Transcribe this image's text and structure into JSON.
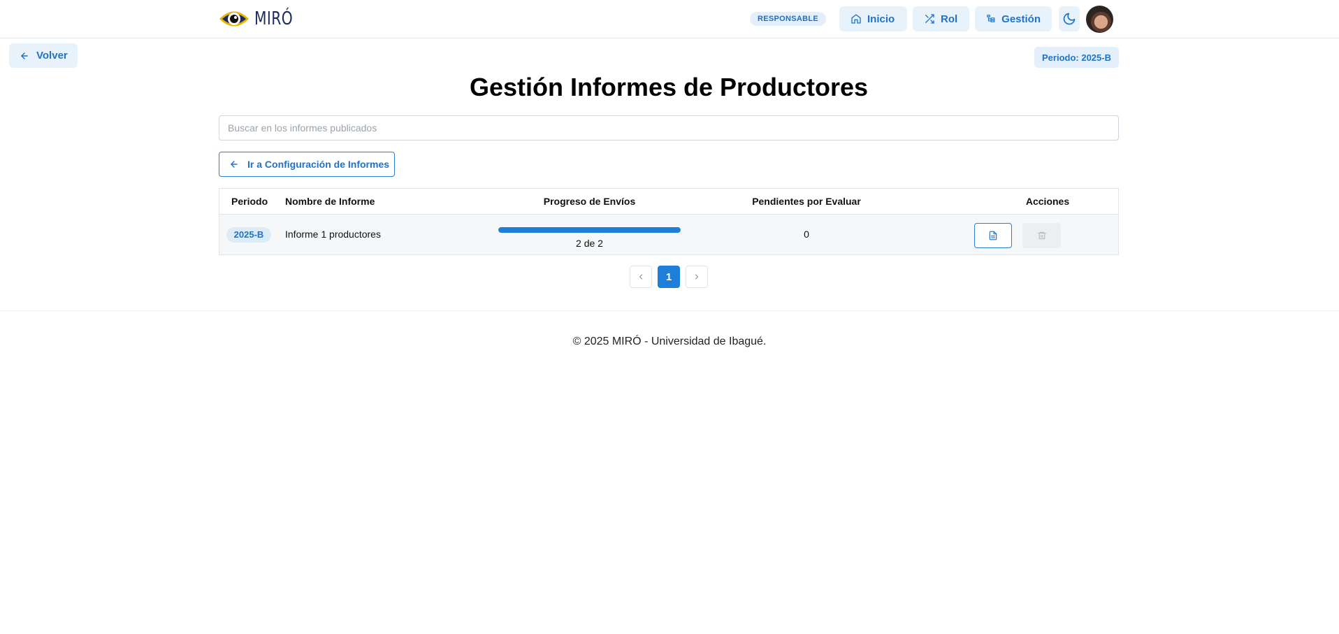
{
  "header": {
    "brand": "MIRÓ",
    "role_badge": "RESPONSABLE",
    "nav": {
      "inicio": "Inicio",
      "rol": "Rol",
      "gestion": "Gestión"
    },
    "theme_icon": "moon-icon",
    "avatar_icon": "user-avatar"
  },
  "toolbar": {
    "back_label": "Volver",
    "period_badge": "Periodo: 2025-B"
  },
  "page": {
    "title": "Gestión Informes de Productores",
    "search_placeholder": "Buscar en los informes publicados",
    "config_button": "Ir a Configuración de Informes"
  },
  "table": {
    "headers": [
      "Periodo",
      "Nombre de Informe",
      "Progreso de Envíos",
      "Pendientes por Evaluar",
      "Acciones"
    ],
    "rows": [
      {
        "periodo": "2025-B",
        "nombre": "Informe 1 productores",
        "progreso_text": "2 de 2",
        "progreso_fraction": 1.0,
        "pendientes": "0",
        "actions": [
          "document-icon",
          "trash-icon"
        ]
      }
    ]
  },
  "pagination": {
    "current": "1",
    "prev_icon": "chevron-left-icon",
    "next_icon": "chevron-right-icon"
  },
  "footer": {
    "text": "© 2025 MIRÓ - Universidad de Ibagué."
  },
  "colors": {
    "accent": "#1e7fd8",
    "accent_bg": "#e8f2fb",
    "brand_dark": "#1c2c5b"
  }
}
